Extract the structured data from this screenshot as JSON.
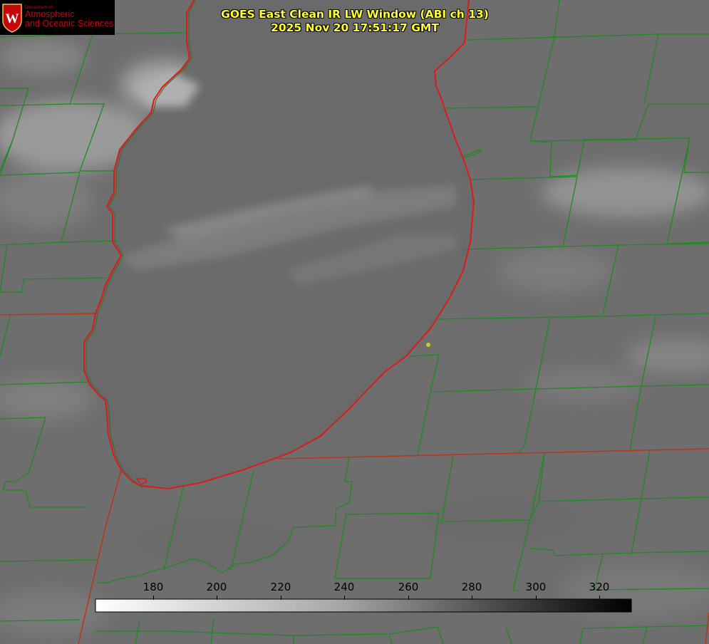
{
  "header": {
    "title_line1": "GOES East Clean IR LW Window (ABI ch 13)",
    "title_line2": "2025 Nov 20 17:51:17 GMT",
    "text_color": "#ffff33"
  },
  "logo": {
    "line1": "Department of",
    "line2": "Atmospheric",
    "line3": "and Oceanic Sciences",
    "text_color": "#c5050c",
    "seal_letter": "W"
  },
  "colorbar": {
    "ticks": [
      "180",
      "200",
      "220",
      "240",
      "260",
      "280",
      "300",
      "320"
    ],
    "gradient_from": "#ffffff",
    "gradient_to": "#000000"
  },
  "map": {
    "water_body": "lake",
    "lakeshore_color": "#dd1a1a",
    "county_border_color": "#1f8a1f",
    "state_border_color": "#b8361f",
    "station_marker_color": "#cccc22",
    "background_gray": "#6f6f6f"
  }
}
